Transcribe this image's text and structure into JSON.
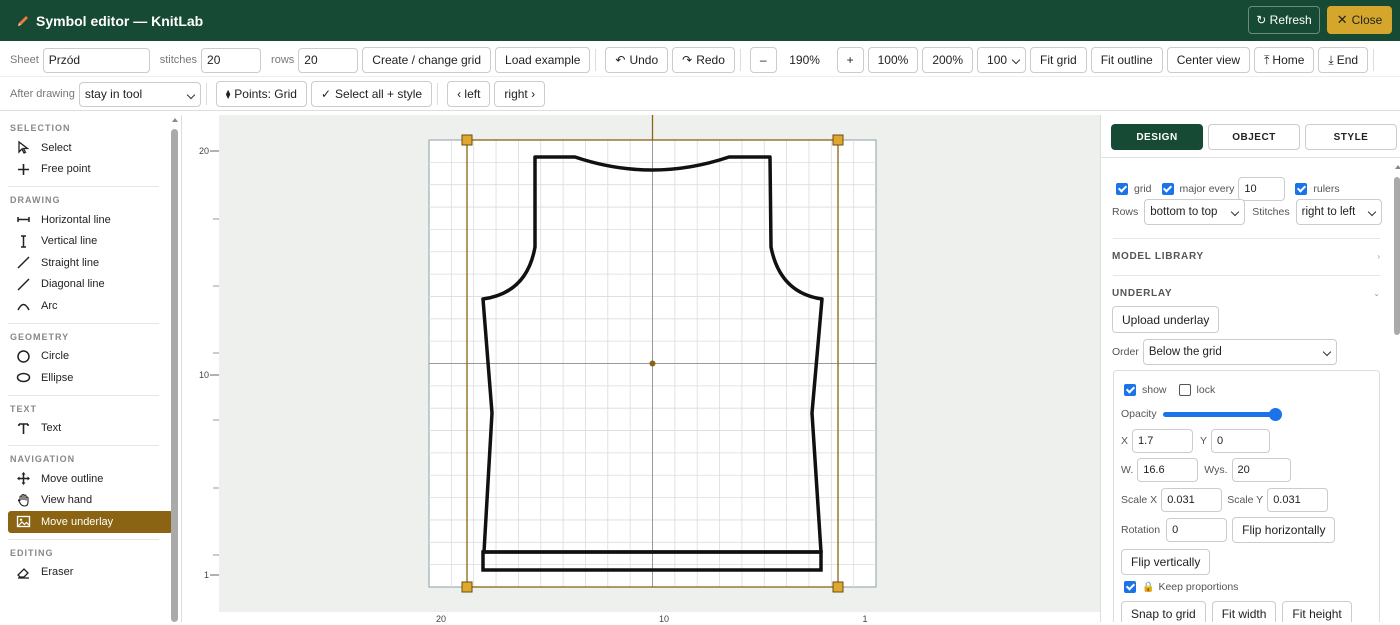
{
  "app": {
    "title": "Symbol editor — KnitLab",
    "refresh_label": "↻ Refresh",
    "close_label": "Close"
  },
  "toolbar1": {
    "sheet_label": "Sheet",
    "sheet_value": "Przód",
    "stitches_label": "stitches",
    "stitches_value": "20",
    "rows_label": "rows",
    "rows_value": "20",
    "create_grid": "Create / change grid",
    "load_example": "Load example",
    "undo": "Undo",
    "redo": "Redo",
    "zoom_out": "–",
    "zoom_value": "190%",
    "zoom_in": "+",
    "zoom_100": "100%",
    "zoom_200": "200%",
    "zoom_select": "100",
    "fit_grid": "Fit grid",
    "fit_outline": "Fit outline",
    "center_view": "Center view",
    "home": "Home",
    "end": "End"
  },
  "toolbar2": {
    "after_drawing_label": "After drawing",
    "after_drawing_value": "stay in tool",
    "points_grid": "Points: Grid",
    "select_all": "Select all + style",
    "left": "‹ left",
    "right": "right ›"
  },
  "sidebar": {
    "selection": {
      "title": "SELECTION",
      "items": [
        "Select",
        "Free point"
      ]
    },
    "drawing": {
      "title": "DRAWING",
      "items": [
        "Horizontal line",
        "Vertical line",
        "Straight line",
        "Diagonal line",
        "Arc"
      ]
    },
    "geometry": {
      "title": "GEOMETRY",
      "items": [
        "Circle",
        "Ellipse"
      ]
    },
    "text": {
      "title": "TEXT",
      "items": [
        "Text"
      ]
    },
    "navigation": {
      "title": "NAVIGATION",
      "items": [
        "Move outline",
        "View hand",
        "Move underlay"
      ]
    },
    "editing": {
      "title": "EDITING",
      "items": [
        "Eraser"
      ]
    },
    "active_tool": "Move underlay"
  },
  "canvas": {
    "left_ruler": [
      "20",
      "10",
      "1"
    ],
    "bottom_ruler": [
      "20",
      "10",
      "1"
    ]
  },
  "rpanel": {
    "tabs": [
      "DESIGN",
      "OBJECT",
      "STYLE"
    ],
    "grid_label": "grid",
    "major_every_label": "major every",
    "major_every_value": "10",
    "rulers_label": "rulers",
    "rows_label": "Rows",
    "rows_value": "bottom to top",
    "stitches_label": "Stitches",
    "stitches_value": "right to left",
    "model_library": "MODEL LIBRARY",
    "underlay": "UNDERLAY",
    "upload_underlay": "Upload underlay",
    "order_label": "Order",
    "order_value": "Below the grid",
    "show_label": "show",
    "lock_label": "lock",
    "opacity_label": "Opacity",
    "x_label": "X",
    "x_value": "1.7",
    "y_label": "Y",
    "y_value": "0",
    "w_label": "W.",
    "w_value": "16.6",
    "wys_label": "Wys.",
    "wys_value": "20",
    "scalex_label": "Scale X",
    "scalex_value": "0.031",
    "scaley_label": "Scale Y",
    "scaley_value": "0.031",
    "rotation_label": "Rotation",
    "rotation_value": "0",
    "flip_h": "Flip horizontally",
    "flip_v": "Flip vertically",
    "keep_proportions": "Keep proportions",
    "snap_to_grid": "Snap to grid",
    "fit_width": "Fit width",
    "fit_height": "Fit height"
  },
  "colors": {
    "header": "#174a35",
    "accent": "#d4a72c",
    "active_tool": "#8a6412",
    "underlay_frame": "#8a6412"
  }
}
